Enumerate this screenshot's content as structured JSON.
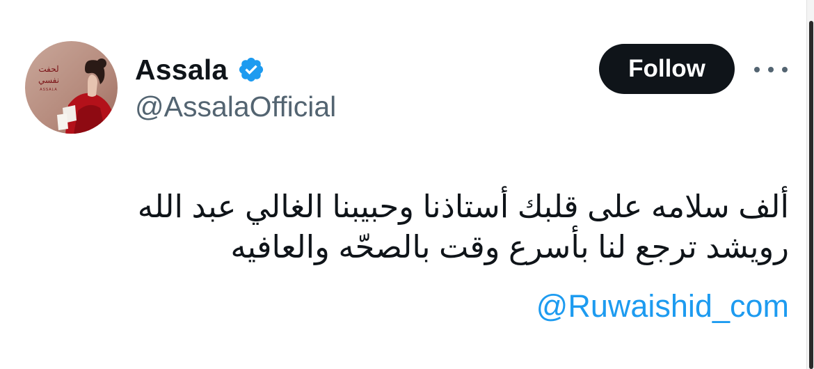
{
  "header": {
    "display_name": "Assala",
    "handle": "@AssalaOfficial",
    "verified": true,
    "follow_label": "Follow",
    "more_icon": "more-horizontal-icon"
  },
  "avatar": {
    "album_title_line1": "لحفت",
    "album_title_line2": "نفسي",
    "album_subtitle": "ASSALA"
  },
  "tweet": {
    "line1": "ألف سلامه على قلبك أستاذنا وحبيبنا الغالي عبد الله",
    "line2": "رويشد ترجع لنا بأسرع وقت بالصحّه والعافيه",
    "mention": "@Ruwaishid_com"
  },
  "colors": {
    "text": "#0f1419",
    "secondary": "#536471",
    "link": "#1d9bf0",
    "verified": "#1d9bf0",
    "follow_bg": "#0f1419"
  }
}
